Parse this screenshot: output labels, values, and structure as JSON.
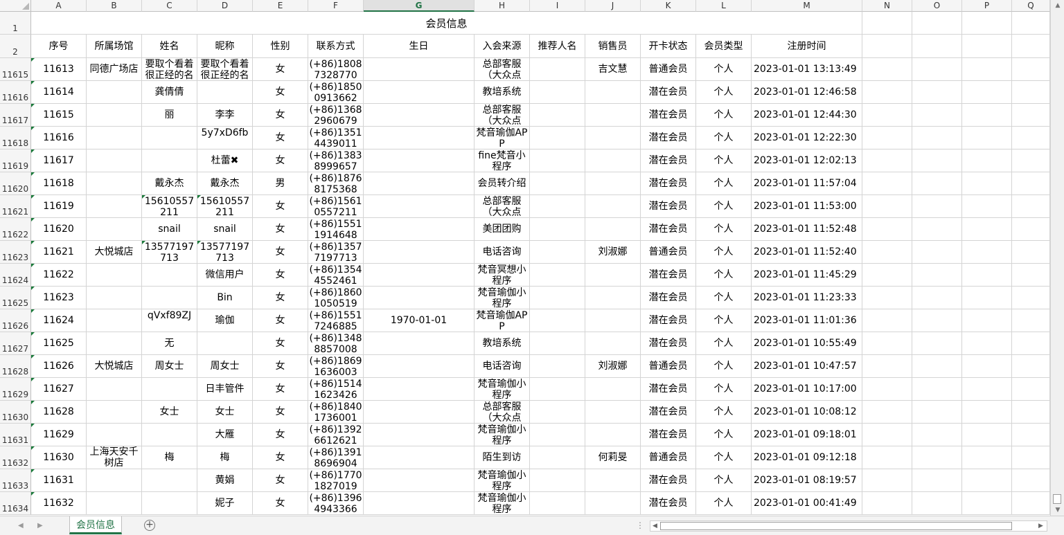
{
  "columns": [
    "A",
    "B",
    "C",
    "D",
    "E",
    "F",
    "G",
    "H",
    "I",
    "J",
    "K",
    "L",
    "M",
    "N",
    "O",
    "P",
    "Q"
  ],
  "selected_column": "G",
  "title_row": {
    "number": "1",
    "title": "会员信息"
  },
  "header_row": {
    "number": "2",
    "labels": [
      "序号",
      "所属场馆",
      "姓名",
      "昵称",
      "性别",
      "联系方式",
      "生日",
      "入会来源",
      "推荐人名",
      "销售员",
      "开卡状态",
      "会员类型",
      "注册时间"
    ]
  },
  "rows": [
    {
      "num": "11615",
      "cells": [
        "11613",
        "同德广场店",
        "要取个看着很正经的名",
        "要取个看着很正经的名",
        "女",
        "(+86)1808\n7328770",
        "",
        "总部客服（大众点",
        "",
        "吉文慧",
        "普通会员",
        "个人",
        "2023-01-01 13:13:49"
      ]
    },
    {
      "num": "11616",
      "cells": [
        "11614",
        "",
        "龚倩倩",
        "",
        "女",
        "(+86)1850\n0913662",
        "",
        "教培系统",
        "",
        "",
        "潜在会员",
        "个人",
        "2023-01-01 12:46:58"
      ]
    },
    {
      "num": "11617",
      "cells": [
        "11615",
        "",
        "丽",
        "李李",
        "女",
        "(+86)1368\n2960679",
        "",
        "总部客服（大众点",
        "",
        "",
        "潜在会员",
        "个人",
        "2023-01-01 12:44:30"
      ]
    },
    {
      "num": "11618",
      "cells": [
        "11616",
        "",
        "",
        "5y7xD6fb",
        "女",
        "(+86)1351\n4439011",
        "",
        "梵音瑜伽APP",
        "",
        "",
        "潜在会员",
        "个人",
        "2023-01-01 12:22:30"
      ]
    },
    {
      "num": "11619",
      "cells": [
        "11617",
        "",
        "",
        "杜蕾✖",
        "女",
        "(+86)1383\n8999657",
        "",
        "fine梵音小程序",
        "",
        "",
        "潜在会员",
        "个人",
        "2023-01-01 12:02:13"
      ]
    },
    {
      "num": "11620",
      "cells": [
        "11618",
        "",
        "戴永杰",
        "戴永杰",
        "男",
        "(+86)1876\n8175368",
        "",
        "会员转介绍",
        "",
        "",
        "潜在会员",
        "个人",
        "2023-01-01 11:57:04"
      ]
    },
    {
      "num": "11621",
      "cells": [
        "11619",
        "",
        "15610557211",
        "15610557211",
        "女",
        "(+86)1561\n0557211",
        "",
        "总部客服（大众点",
        "",
        "",
        "潜在会员",
        "个人",
        "2023-01-01 11:53:00"
      ]
    },
    {
      "num": "11622",
      "cells": [
        "11620",
        "",
        "snail",
        "snail",
        "女",
        "(+86)1551\n1914648",
        "",
        "美团团购",
        "",
        "",
        "潜在会员",
        "个人",
        "2023-01-01 11:52:48"
      ]
    },
    {
      "num": "11623",
      "cells": [
        "11621",
        "大悦城店",
        "13577197713",
        "13577197713",
        "女",
        "(+86)1357\n7197713",
        "",
        "电话咨询",
        "",
        "刘淑娜",
        "普通会员",
        "个人",
        "2023-01-01 11:52:40"
      ]
    },
    {
      "num": "11624",
      "cells": [
        "11622",
        "",
        "",
        "微信用户",
        "女",
        "(+86)1354\n4552461",
        "",
        "梵音冥想小程序",
        "",
        "",
        "潜在会员",
        "个人",
        "2023-01-01 11:45:29"
      ]
    },
    {
      "num": "11625",
      "cells": [
        "11623",
        "",
        "",
        "Bin",
        "女",
        "(+86)1860\n1050519",
        "",
        "梵音瑜伽小程序",
        "",
        "",
        "潜在会员",
        "个人",
        "2023-01-01 11:23:33"
      ]
    },
    {
      "num": "11626",
      "cells": [
        "11624",
        "",
        "qVxf89ZJ",
        "瑜伽",
        "女",
        "(+86)1551\n7246885",
        "1970-01-01",
        "梵音瑜伽APP",
        "",
        "",
        "潜在会员",
        "个人",
        "2023-01-01 11:01:36"
      ]
    },
    {
      "num": "11627",
      "cells": [
        "11625",
        "",
        "无",
        "",
        "女",
        "(+86)1348\n8857008",
        "",
        "教培系统",
        "",
        "",
        "潜在会员",
        "个人",
        "2023-01-01 10:55:49"
      ]
    },
    {
      "num": "11628",
      "cells": [
        "11626",
        "大悦城店",
        "周女士",
        "周女士",
        "女",
        "(+86)1869\n1636003",
        "",
        "电话咨询",
        "",
        "刘淑娜",
        "普通会员",
        "个人",
        "2023-01-01 10:47:57"
      ]
    },
    {
      "num": "11629",
      "cells": [
        "11627",
        "",
        "",
        "日丰管件",
        "女",
        "(+86)1514\n1623426",
        "",
        "梵音瑜伽小程序",
        "",
        "",
        "潜在会员",
        "个人",
        "2023-01-01 10:17:00"
      ]
    },
    {
      "num": "11630",
      "cells": [
        "11628",
        "",
        "女士",
        "女士",
        "女",
        "(+86)1840\n1736001",
        "",
        "总部客服（大众点",
        "",
        "",
        "潜在会员",
        "个人",
        "2023-01-01 10:08:12"
      ]
    },
    {
      "num": "11631",
      "cells": [
        "11629",
        "",
        "",
        "大雁",
        "女",
        "(+86)1392\n6612621",
        "",
        "梵音瑜伽小程序",
        "",
        "",
        "潜在会员",
        "个人",
        "2023-01-01 09:18:01"
      ]
    },
    {
      "num": "11632",
      "cells": [
        "11630",
        "上海天安千树店",
        "梅",
        "梅",
        "女",
        "(+86)1391\n8696904",
        "",
        "陌生到访",
        "",
        "何莉旻",
        "普通会员",
        "个人",
        "2023-01-01 09:12:18"
      ]
    },
    {
      "num": "11633",
      "cells": [
        "11631",
        "",
        "",
        "黄娟",
        "女",
        "(+86)1770\n1827019",
        "",
        "梵音瑜伽小程序",
        "",
        "",
        "潜在会员",
        "个人",
        "2023-01-01 08:19:57"
      ]
    },
    {
      "num": "11634",
      "cells": [
        "11632",
        "",
        "",
        "妮子",
        "女",
        "(+86)1396\n4943366",
        "",
        "梵音瑜伽小程序",
        "",
        "",
        "潜在会员",
        "个人",
        "2023-01-01 00:41:49"
      ]
    }
  ],
  "sheet_tab": "会员信息",
  "add_sheet": "+",
  "nav_prev": "◀",
  "nav_next": "▶",
  "more": "⋮"
}
